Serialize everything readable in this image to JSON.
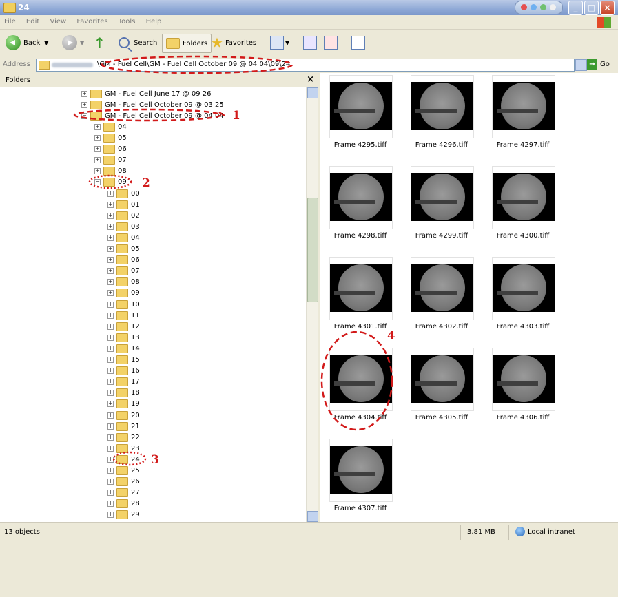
{
  "window": {
    "title": "24"
  },
  "menu": [
    "File",
    "Edit",
    "View",
    "Favorites",
    "Tools",
    "Help"
  ],
  "toolbar": {
    "back": "Back",
    "search": "Search",
    "folders": "Folders",
    "favorites": "Favorites"
  },
  "address": {
    "label": "Address",
    "path": "\\GM - Fuel Cell\\GM - Fuel Cell October 09 @ 04 04\\09\\24",
    "go": "Go"
  },
  "folders_panel": {
    "title": "Folders",
    "close": "×"
  },
  "tree": {
    "top": [
      {
        "label": "GM - Fuel Cell June 17 @ 09 26",
        "pm": "+"
      },
      {
        "label": "GM - Fuel Cell October 09 @ 03 25",
        "pm": "+"
      },
      {
        "label": "GM - Fuel Cell October 09 @ 04 04",
        "pm": "−"
      }
    ],
    "level1": [
      "04",
      "05",
      "06",
      "07",
      "08",
      "09"
    ],
    "level2": [
      "00",
      "01",
      "02",
      "03",
      "04",
      "05",
      "06",
      "07",
      "08",
      "09",
      "10",
      "11",
      "12",
      "13",
      "14",
      "15",
      "16",
      "17",
      "18",
      "19",
      "20",
      "21",
      "22",
      "23",
      "24",
      "25",
      "26",
      "27",
      "28",
      "29"
    ]
  },
  "thumbnails": [
    "Frame 4295.tiff",
    "Frame 4296.tiff",
    "Frame 4297.tiff",
    "Frame 4298.tiff",
    "Frame 4299.tiff",
    "Frame 4300.tiff",
    "Frame 4301.tiff",
    "Frame 4302.tiff",
    "Frame 4303.tiff",
    "Frame 4304.tiff",
    "Frame 4305.tiff",
    "Frame 4306.tiff",
    "Frame 4307.tiff"
  ],
  "status": {
    "objects": "13 objects",
    "size": "3.81 MB",
    "zone": "Local intranet"
  },
  "annotations": [
    "1",
    "2",
    "3",
    "4"
  ],
  "colors": {
    "annotation": "#d21a1a",
    "titlebar": "#8fa9d6",
    "folder": "#f3d268"
  }
}
